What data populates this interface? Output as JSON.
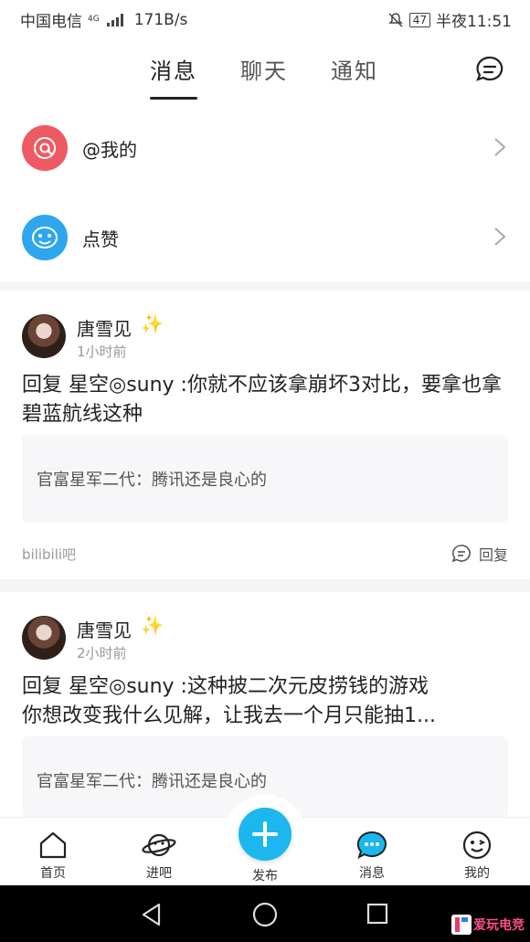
{
  "status": {
    "carrier": "中国电信",
    "net": "4G",
    "speed": "171B/s",
    "battery": "47",
    "time": "半夜11:51"
  },
  "tabs": [
    {
      "label": "消息",
      "active": true
    },
    {
      "label": "聊天",
      "active": false
    },
    {
      "label": "通知",
      "active": false
    }
  ],
  "rows": [
    {
      "label": "@我的",
      "icon": "at-icon",
      "color": "#ee5a62"
    },
    {
      "label": "点赞",
      "icon": "like-icon",
      "color": "#2ea6ee"
    }
  ],
  "cards": [
    {
      "user": "唐雪见",
      "badge": "✨",
      "time": "1小时前",
      "reply": "回复 星空◎suny :你就不应该拿崩坏3对比，要拿也拿碧蓝航线这种",
      "quote": "官富星军二代：腾讯还是良心的",
      "forum": "bilibili吧",
      "reply_label": "回复"
    },
    {
      "user": "唐雪见",
      "badge": "✨",
      "time": "2小时前",
      "reply_line1": "回复 星空◎suny :这种披二次元皮捞钱的游戏",
      "reply_line2": "你想改变我什么见解，让我去一个月只能抽1...",
      "quote": "官富星军二代：腾讯还是良心的"
    }
  ],
  "nav": [
    {
      "label": "首页",
      "icon": "home-icon"
    },
    {
      "label": "进吧",
      "icon": "planet-icon"
    },
    {
      "label": "发布",
      "icon": "plus-icon"
    },
    {
      "label": "消息",
      "icon": "message-icon"
    },
    {
      "label": "我的",
      "icon": "profile-icon"
    }
  ],
  "accent": "#1bb7ee",
  "watermark": "爱玩电竞"
}
